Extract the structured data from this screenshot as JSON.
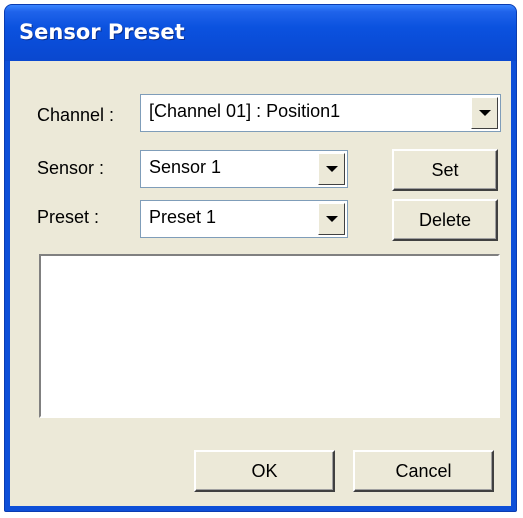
{
  "window": {
    "title": "Sensor Preset"
  },
  "channel": {
    "label": "Channel :",
    "value": "[Channel 01] : Position1"
  },
  "sensor": {
    "label": "Sensor :",
    "value": "Sensor 1"
  },
  "preset": {
    "label": "Preset :",
    "value": "Preset 1"
  },
  "buttons": {
    "set": "Set",
    "delete": "Delete",
    "ok": "OK",
    "cancel": "Cancel"
  },
  "colors": {
    "titlebar": "#0b52df",
    "face": "#ece9d8"
  }
}
